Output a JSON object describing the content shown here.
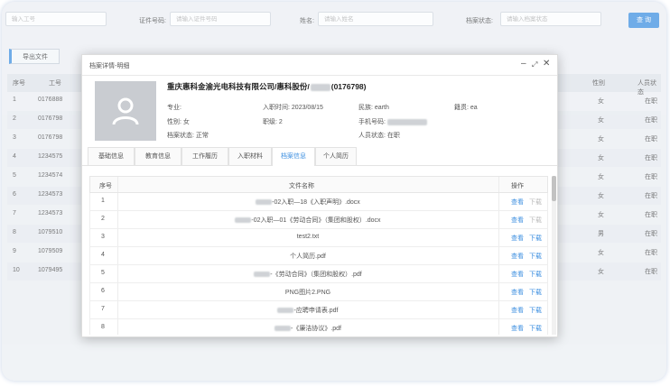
{
  "search": {
    "emp_placeholder": "输入工号",
    "id_label": "证件号码:",
    "id_placeholder": "请输入证件号码",
    "name_label": "姓名:",
    "name_placeholder": "请输入姓名",
    "status_label": "档案状态:",
    "status_placeholder": "请输入档案状态",
    "query_button": "查 询"
  },
  "toolbar": {
    "export_button": "导出文件"
  },
  "bg_table": {
    "headers": {
      "seq": "序号",
      "emp_no": "工号",
      "gender": "性别",
      "status": "人员状态"
    },
    "rows": [
      {
        "seq": "1",
        "emp_no": "0176888",
        "gender": "女",
        "status": "在职"
      },
      {
        "seq": "2",
        "emp_no": "0176798",
        "gender": "女",
        "status": "在职"
      },
      {
        "seq": "3",
        "emp_no": "0176798",
        "gender": "女",
        "status": "在职"
      },
      {
        "seq": "4",
        "emp_no": "1234575",
        "gender": "女",
        "status": "在职"
      },
      {
        "seq": "5",
        "emp_no": "1234574",
        "gender": "女",
        "status": "在职"
      },
      {
        "seq": "6",
        "emp_no": "1234573",
        "gender": "女",
        "status": "在职"
      },
      {
        "seq": "7",
        "emp_no": "1234573",
        "gender": "女",
        "status": "在职"
      },
      {
        "seq": "8",
        "emp_no": "1079510",
        "gender": "男",
        "status": "在职"
      },
      {
        "seq": "9",
        "emp_no": "1079509",
        "gender": "女",
        "status": "在职"
      },
      {
        "seq": "10",
        "emp_no": "1079495",
        "gender": "女",
        "status": "在职"
      }
    ]
  },
  "modal": {
    "title": "档案详情-明细",
    "company": "重庆惠科金渝光电科技有限公司/惠科股份/",
    "emp_code": "(0176798)",
    "major_label": "专业:",
    "gender_label": "性别:",
    "gender_value": "女",
    "archive_label": "档案状态:",
    "archive_value": "正常",
    "entry_label": "入职时间:",
    "entry_value": "2023/08/15",
    "rank_label": "职级:",
    "rank_value": "2",
    "nation_label": "民族:",
    "nation_value": "earth",
    "phone_label": "手机号码:",
    "person_status_label": "人员状态:",
    "person_status_value": "在职",
    "origin_label": "籍贯:",
    "origin_value": "ea",
    "tabs": [
      "基础信息",
      "教育信息",
      "工作履历",
      "入职材料",
      "档案信息",
      "个人简历"
    ],
    "active_tab": "档案信息",
    "grid": {
      "headers": {
        "seq": "序号",
        "file": "文件名称",
        "ops": "操作"
      },
      "view_label": "查看",
      "download_label": "下载",
      "rows": [
        {
          "seq": "1",
          "file": "-02入职—18《入职声明》.docx",
          "blur": true,
          "download_enabled": false
        },
        {
          "seq": "2",
          "file": "-02入职—01《劳动合同》（集团和股权）.docx",
          "blur": true,
          "download_enabled": false
        },
        {
          "seq": "3",
          "file": "test2.txt",
          "blur": false,
          "download_enabled": true
        },
        {
          "seq": "4",
          "file": "个人简历.pdf",
          "blur": false,
          "download_enabled": true
        },
        {
          "seq": "5",
          "file": "-《劳动合同》（集团和股权）.pdf",
          "blur": true,
          "download_enabled": true
        },
        {
          "seq": "6",
          "file": "PNG图片2.PNG",
          "blur": false,
          "download_enabled": true
        },
        {
          "seq": "7",
          "file": "-应聘申请表.pdf",
          "blur": true,
          "download_enabled": true
        },
        {
          "seq": "8",
          "file": "-《廉洁协议》.pdf",
          "blur": true,
          "download_enabled": true
        }
      ]
    }
  }
}
